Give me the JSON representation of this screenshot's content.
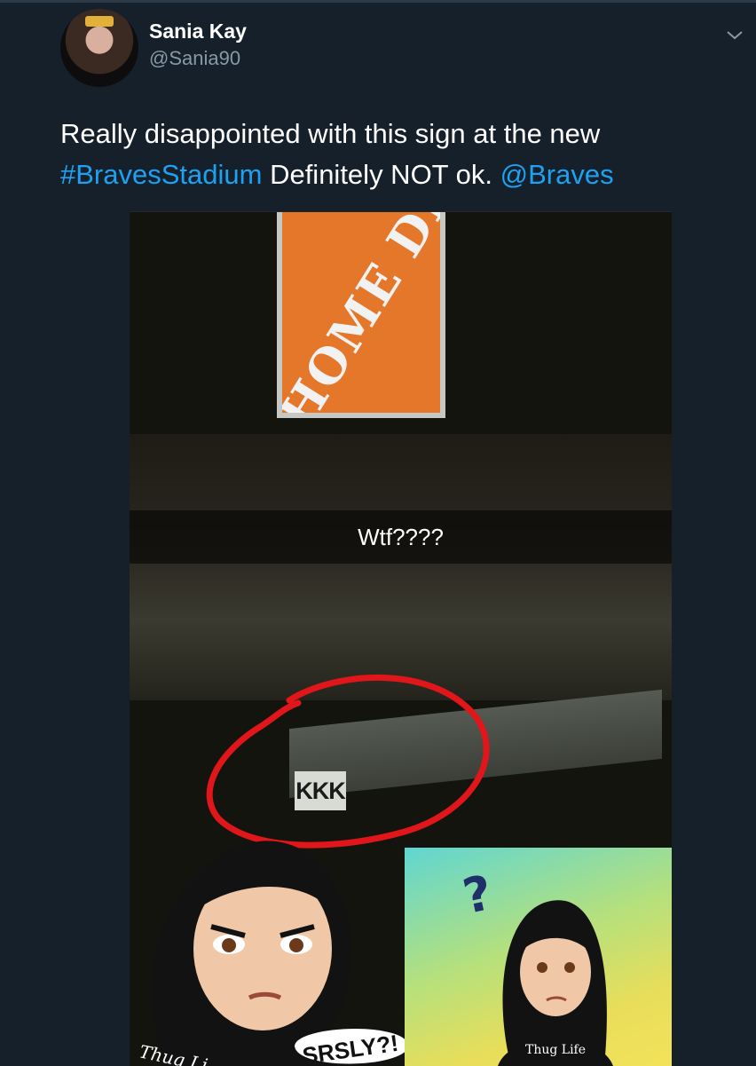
{
  "tweet": {
    "author_name": "Sania Kay",
    "author_handle": "@Sania90",
    "text_plain_1": "Really disappointed with this sign at the new",
    "hashtag": "#BravesStadium",
    "text_plain_2": " Definitely NOT ok. ",
    "mention": "@Braves"
  },
  "media": {
    "sign_text": "THE HOME DEPOT",
    "caption": "Wtf????",
    "railing_sign": "KKK",
    "sticker_text": "SRSLY?!",
    "shirt_text": "Thug Life",
    "shirt_text_left": "Thug Li",
    "question_mark": "?"
  },
  "colors": {
    "background": "#15202b",
    "link": "#1da1f2",
    "circle": "#e0161a",
    "sign_orange": "#e5772b"
  },
  "icons": {
    "chevron": "chevron-down-icon"
  }
}
